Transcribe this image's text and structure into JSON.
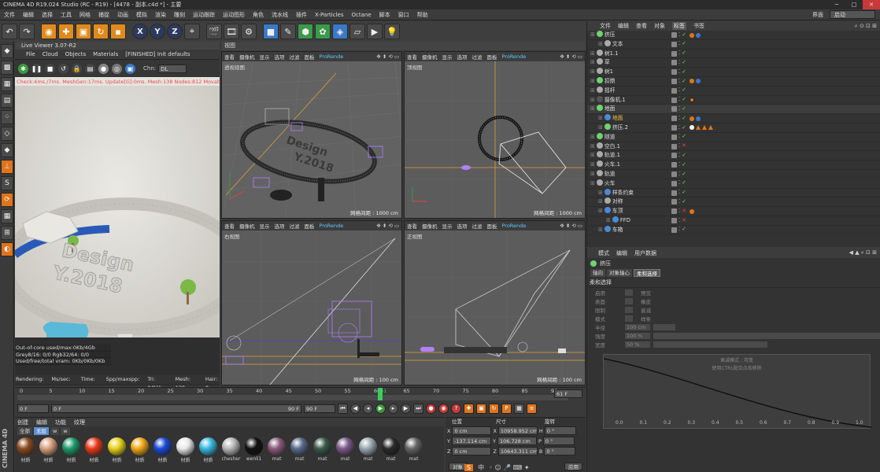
{
  "title": "CINEMA 4D R19.024 Studio (RC - R19) - [4478 - 副本.c4d *] - 主要",
  "menu": [
    "文件",
    "编辑",
    "选择",
    "工具",
    "网格",
    "捕捉",
    "动画",
    "模拟",
    "渲染",
    "雕刻",
    "运动跟踪",
    "运动图形",
    "角色",
    "流水线",
    "插件",
    "X-Particles",
    "Octane",
    "脚本",
    "窗口",
    "帮助"
  ],
  "interface_label": "界面",
  "interface_value": "启动",
  "toolbar": {
    "x_label": "X",
    "y_label": "Y",
    "z_label": "Z"
  },
  "liveviewer": {
    "title": "Live Viewer 3.07-R2",
    "menu": [
      "File",
      "Cloud",
      "Objects",
      "Materials",
      "[FINISHED] Init defaults"
    ],
    "chn_label": "Chn:",
    "chn_value": "DL",
    "status": "Check:4ms./7ms. MeshGen:17ms. Update[G]:0ms. Mesh:138 Nodes:812 Movable:138",
    "info": [
      "Out-of-core used/max:0Kb/4Gb",
      "Grey8/16: 0/0        Rgb32/64: 0/0",
      "Used/free/total vram: 0Kb/0Kb/0Kb"
    ],
    "footer": [
      "Rendering:",
      "Ms/sec: ...",
      "Time: ...",
      "Spp/maxspp: ...",
      "Tri: 0/81k",
      "Mesh: 138",
      "Hair: 0"
    ]
  },
  "viewport_tab": "视图",
  "viewport_menu": [
    "查看",
    "摄像机",
    "显示",
    "选项",
    "过滤",
    "面板",
    "ProRende"
  ],
  "viewports": [
    {
      "label": "透视视图",
      "grid": "网格间距 : 1000 cm"
    },
    {
      "label": "顶视图",
      "grid": "网格间距 : 1000 cm"
    },
    {
      "label": "右视图",
      "grid": "网格间距 : 100 cm"
    },
    {
      "label": "正视图",
      "grid": "网格间距 : 100 cm"
    }
  ],
  "timeline": {
    "ticks": [
      "0",
      "5",
      "10",
      "15",
      "20",
      "25",
      "30",
      "35",
      "40",
      "45",
      "50",
      "55",
      "60",
      "65",
      "70",
      "75",
      "80",
      "85",
      "90"
    ],
    "current": "61",
    "frame_field": "61 F"
  },
  "playback": {
    "start": "0 F",
    "start2": "0 F",
    "end": "90 F",
    "end2": "90 F"
  },
  "matmgr": {
    "menu": [
      "创建",
      "编辑",
      "功能",
      "纹理"
    ],
    "tabs": [
      "全部",
      "无层",
      "w",
      "w"
    ],
    "materials": [
      {
        "label": "材质",
        "color": "#8b4a1e"
      },
      {
        "label": "材质",
        "color": "#d8a080"
      },
      {
        "label": "材质",
        "color": "#1e9a6a"
      },
      {
        "label": "材质",
        "color": "#e83a1a"
      },
      {
        "label": "材质",
        "color": "#e8d21a"
      },
      {
        "label": "材质",
        "color": "#f0a81a"
      },
      {
        "label": "材质",
        "color": "#1a4ad8"
      },
      {
        "label": "材质",
        "color": "#e8e8e8"
      },
      {
        "label": "材质",
        "color": "#3ab8e0"
      },
      {
        "label": "chesher",
        "color": "#b8b8b8"
      },
      {
        "label": "wenli1",
        "color": "#111111"
      },
      {
        "label": "mat",
        "color": "#8a5a7a"
      },
      {
        "label": "mat",
        "color": "#5a6a8a"
      },
      {
        "label": "mat",
        "color": "#3a5a4a"
      },
      {
        "label": "mat",
        "color": "#7a5a8a"
      },
      {
        "label": "mat",
        "color": "#9aaab0"
      },
      {
        "label": "mat",
        "color": "#2a2a2a"
      },
      {
        "label": "mat",
        "color": "#666666"
      }
    ]
  },
  "coords": {
    "headers": [
      "位置",
      "尺寸",
      "旋转"
    ],
    "rows": [
      {
        "axis": "X",
        "pos": "0 cm",
        "size": "10958.952 cm",
        "rlabel": "H",
        "rot": "0 °"
      },
      {
        "axis": "Y",
        "pos": "-137.114 cm",
        "size": "106.728 cm",
        "rlabel": "P",
        "rot": "0 °"
      },
      {
        "axis": "Z",
        "pos": "0 cm",
        "size": "10643.311 cm",
        "rlabel": "B",
        "rot": "0 °"
      }
    ],
    "obj_button": "对象",
    "apply_button": "应用"
  },
  "objmgr": {
    "menu": [
      "文件",
      "编辑",
      "查看",
      "对象",
      "标签",
      "书签"
    ],
    "items": [
      {
        "name": "挤压",
        "color": "#6fd36f",
        "indent": 0,
        "tag": "dots"
      },
      {
        "name": "文本",
        "color": "#aaaaaa",
        "indent": 1,
        "tag": ""
      },
      {
        "name": "树1.1",
        "color": "#aaaaaa",
        "indent": 0,
        "tag": ""
      },
      {
        "name": "草",
        "color": "#aaaaaa",
        "indent": 0,
        "tag": ""
      },
      {
        "name": "树1",
        "color": "#aaaaaa",
        "indent": 0,
        "tag": ""
      },
      {
        "name": "扣鼎",
        "color": "#6fd36f",
        "indent": 0,
        "tag": "dots"
      },
      {
        "name": "摇杆",
        "color": "#aaaaaa",
        "indent": 0,
        "tag": ""
      },
      {
        "name": "摄像机.1",
        "color": "#555555",
        "indent": 0,
        "tag": "ban"
      },
      {
        "name": "地面",
        "color": "#6fd36f",
        "indent": 0,
        "tag": "",
        "sel": true
      },
      {
        "name": "地面",
        "color": "#4a8ad8",
        "indent": 1,
        "tag": "dots",
        "hl": true
      },
      {
        "name": "挤压.2",
        "color": "#6fd36f",
        "indent": 1,
        "tag": "tri"
      },
      {
        "name": "隧道",
        "color": "#6fd36f",
        "indent": 0,
        "tag": ""
      },
      {
        "name": "空白.1",
        "color": "#aaaaaa",
        "indent": 0,
        "tag": "x"
      },
      {
        "name": "轨道.1",
        "color": "#aaaaaa",
        "indent": 0,
        "tag": ""
      },
      {
        "name": "火车.1",
        "color": "#aaaaaa",
        "indent": 0,
        "tag": ""
      },
      {
        "name": "轨道",
        "color": "#aaaaaa",
        "indent": 0,
        "tag": ""
      },
      {
        "name": "火车",
        "color": "#aaaaaa",
        "indent": 0,
        "tag": ""
      },
      {
        "name": "样条约束",
        "color": "#4a8ad8",
        "indent": 1,
        "tag": ""
      },
      {
        "name": "对称",
        "color": "#aaaaaa",
        "indent": 1,
        "tag": ""
      },
      {
        "name": "车顶",
        "color": "#4a8ad8",
        "indent": 1,
        "tag": "xd"
      },
      {
        "name": "FFD",
        "color": "#4a8ad8",
        "indent": 2,
        "tag": "x"
      },
      {
        "name": "车箱",
        "color": "#4a8ad8",
        "indent": 1,
        "tag": ""
      }
    ]
  },
  "attrmgr": {
    "menu": [
      "模式",
      "编辑",
      "用户数据"
    ],
    "object": "挤压",
    "tabs": [
      "轴向",
      "对象轴心",
      "柔和选择"
    ],
    "section": "柔和选择",
    "rows": [
      [
        "启用",
        "预览"
      ],
      [
        "表面",
        "橡皮"
      ],
      [
        "限制",
        "衰减"
      ],
      [
        "模式",
        "样条"
      ]
    ],
    "sliders": [
      {
        "label": "半径",
        "value": "100 cm"
      },
      {
        "label": "强度",
        "value": "100 %"
      },
      {
        "label": "宽度",
        "value": "50 %"
      }
    ],
    "graph_hint1": "衰减模式 : 可变",
    "graph_hint2": "使用CTRL配合点击移除",
    "graph_x": [
      "0.0",
      "0.1",
      "0.2",
      "0.3",
      "0.4",
      "0.5",
      "0.6",
      "0.7",
      "0.8",
      "0.9",
      "1.0"
    ]
  },
  "render_text": [
    "Design",
    "Y.2018"
  ],
  "status_bottom": "中"
}
